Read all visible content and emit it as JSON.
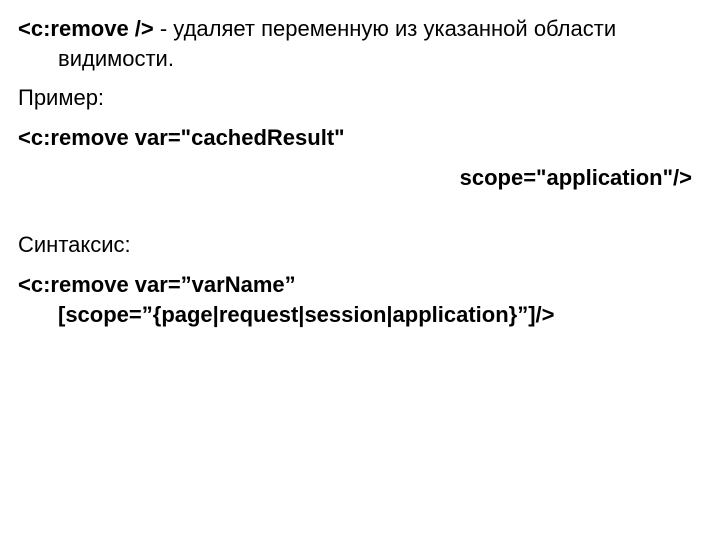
{
  "desc": {
    "tag": "<c:remove />",
    "text": " - удаляет переменную из указанной области видимости."
  },
  "example_label": "Пример:",
  "code_line1": "<c:remove var=\"cachedResult\"",
  "code_line2": "scope=\"application\"/>",
  "syntax_label": "Синтаксис:",
  "syntax_text": "<c:remove var=”varName” [scope=”{page|request|session|application}”]/>"
}
